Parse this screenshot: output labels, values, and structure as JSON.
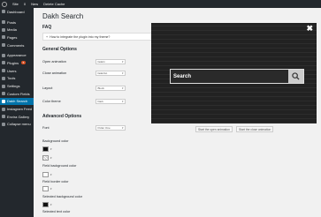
{
  "adminbar": {
    "site": "Site",
    "comments": "0",
    "new": "New",
    "cache": "Delete Cache"
  },
  "sidebar": {
    "items": [
      {
        "label": "Dashboard",
        "icon": "dashboard-icon"
      },
      {
        "label": "Posts",
        "icon": "pin-icon"
      },
      {
        "label": "Media",
        "icon": "media-icon"
      },
      {
        "label": "Pages",
        "icon": "page-icon"
      },
      {
        "label": "Comments",
        "icon": "comment-icon"
      },
      {
        "label": "Appearance",
        "icon": "brush-icon"
      },
      {
        "label": "Plugins",
        "icon": "plug-icon",
        "badge": "5"
      },
      {
        "label": "Users",
        "icon": "user-icon"
      },
      {
        "label": "Tools",
        "icon": "wrench-icon"
      },
      {
        "label": "Settings",
        "icon": "settings-icon"
      },
      {
        "label": "Custom Fields",
        "icon": "fields-icon"
      },
      {
        "label": "Dakh Search",
        "icon": "search-icon"
      },
      {
        "label": "Instagram Feed",
        "icon": "instagram-icon"
      },
      {
        "label": "Envira Gallery",
        "icon": "gallery-icon"
      },
      {
        "label": "Collapse menu",
        "icon": "collapse-icon"
      }
    ]
  },
  "main": {
    "title": "Dakh Search",
    "faq_title": "FAQ",
    "faq_question": "How to integrate the plugin into my theme?",
    "general_title": "General Options",
    "general": [
      {
        "label": "Open animation",
        "value": "fadeIn"
      },
      {
        "label": "Close animation",
        "value": "fadeOut"
      },
      {
        "label": "Layout",
        "value": "Block"
      },
      {
        "label": "Color theme",
        "value": "Dark"
      }
    ],
    "advanced_title": "Advanced Options",
    "font": {
      "label": "Font",
      "value": "Poller One"
    },
    "colors": [
      {
        "label": "Background color",
        "value": "#111111"
      },
      {
        "label": "Field background color",
        "value": "transparent"
      },
      {
        "label": "Field border color",
        "value": "#ffffff"
      },
      {
        "label": "Selected background color",
        "value": "#ffffff"
      },
      {
        "label": "Selected text color",
        "value": "#111111"
      }
    ]
  },
  "preview": {
    "close": "✖",
    "search_text": "Search",
    "open_button": "Start the open animation",
    "close_button": "Start the close animation"
  }
}
